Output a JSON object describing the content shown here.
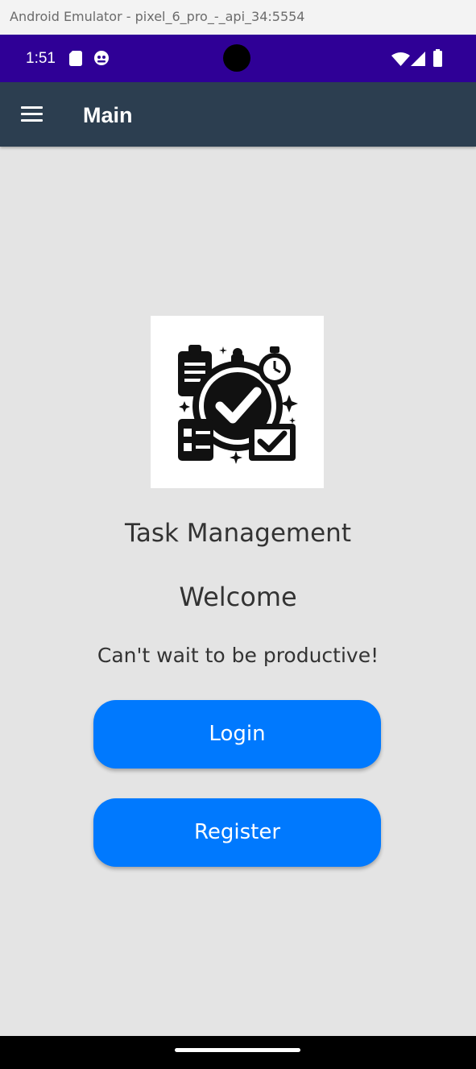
{
  "window": {
    "title": "Android Emulator - pixel_6_pro_-_api_34:5554"
  },
  "status_bar": {
    "time": "1:51",
    "left_icons": [
      "sd-card-icon",
      "android-debug-icon"
    ],
    "right_icons": [
      "wifi-icon",
      "cell-signal-icon",
      "battery-icon"
    ],
    "background": "#2f0096"
  },
  "app_bar": {
    "title": "Main",
    "menu_icon": "hamburger-menu-icon",
    "background": "#2c3e50"
  },
  "main": {
    "logo_icon": "task-management-clock-checklist-icon",
    "title": "Task Management",
    "welcome": "Welcome",
    "subtitle": "Can't wait to be productive!",
    "login_label": "Login",
    "register_label": "Register",
    "button_color": "#0079fe",
    "background": "#e4e4e4"
  }
}
